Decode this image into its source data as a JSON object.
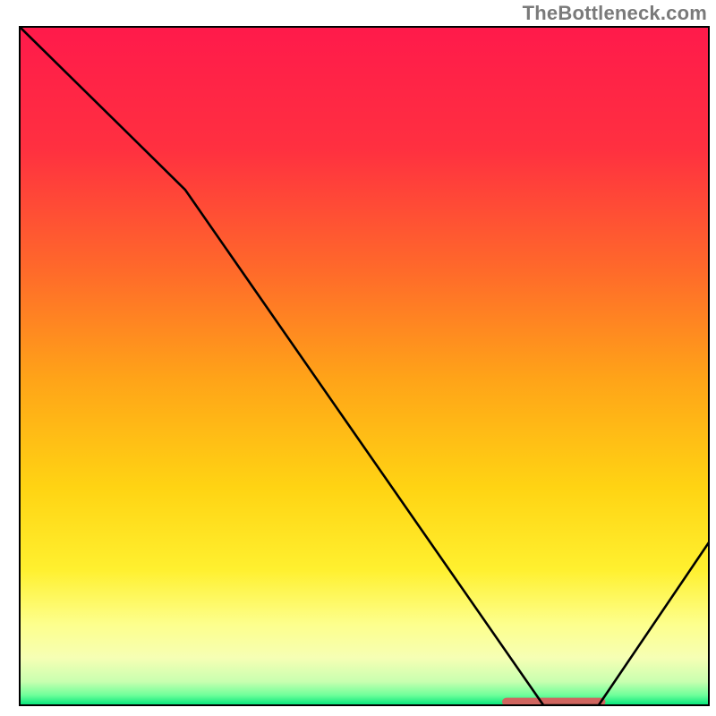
{
  "watermark": "TheBottleneck.com",
  "chart_data": {
    "type": "line",
    "title": "",
    "xlabel": "",
    "ylabel": "",
    "xlim": [
      0,
      100
    ],
    "ylim": [
      0,
      100
    ],
    "x": [
      0,
      24,
      76,
      84,
      100
    ],
    "values": [
      100,
      76,
      0,
      0,
      24
    ],
    "min_segment": {
      "x_start": 70,
      "x_end": 85,
      "y": 0
    },
    "gradient_stops": [
      {
        "offset": 0.0,
        "color": "#ff1a4b"
      },
      {
        "offset": 0.18,
        "color": "#ff3040"
      },
      {
        "offset": 0.36,
        "color": "#ff6a2a"
      },
      {
        "offset": 0.52,
        "color": "#ffa418"
      },
      {
        "offset": 0.68,
        "color": "#ffd413"
      },
      {
        "offset": 0.8,
        "color": "#fff02f"
      },
      {
        "offset": 0.88,
        "color": "#fdff8c"
      },
      {
        "offset": 0.93,
        "color": "#f6ffb4"
      },
      {
        "offset": 0.965,
        "color": "#c9ffb0"
      },
      {
        "offset": 0.985,
        "color": "#6fff9a"
      },
      {
        "offset": 1.0,
        "color": "#00e57a"
      }
    ],
    "accent_bar": {
      "color": "#d0655f",
      "y": 0.5,
      "x_start": 70,
      "x_end": 85,
      "height": 1.2
    }
  }
}
